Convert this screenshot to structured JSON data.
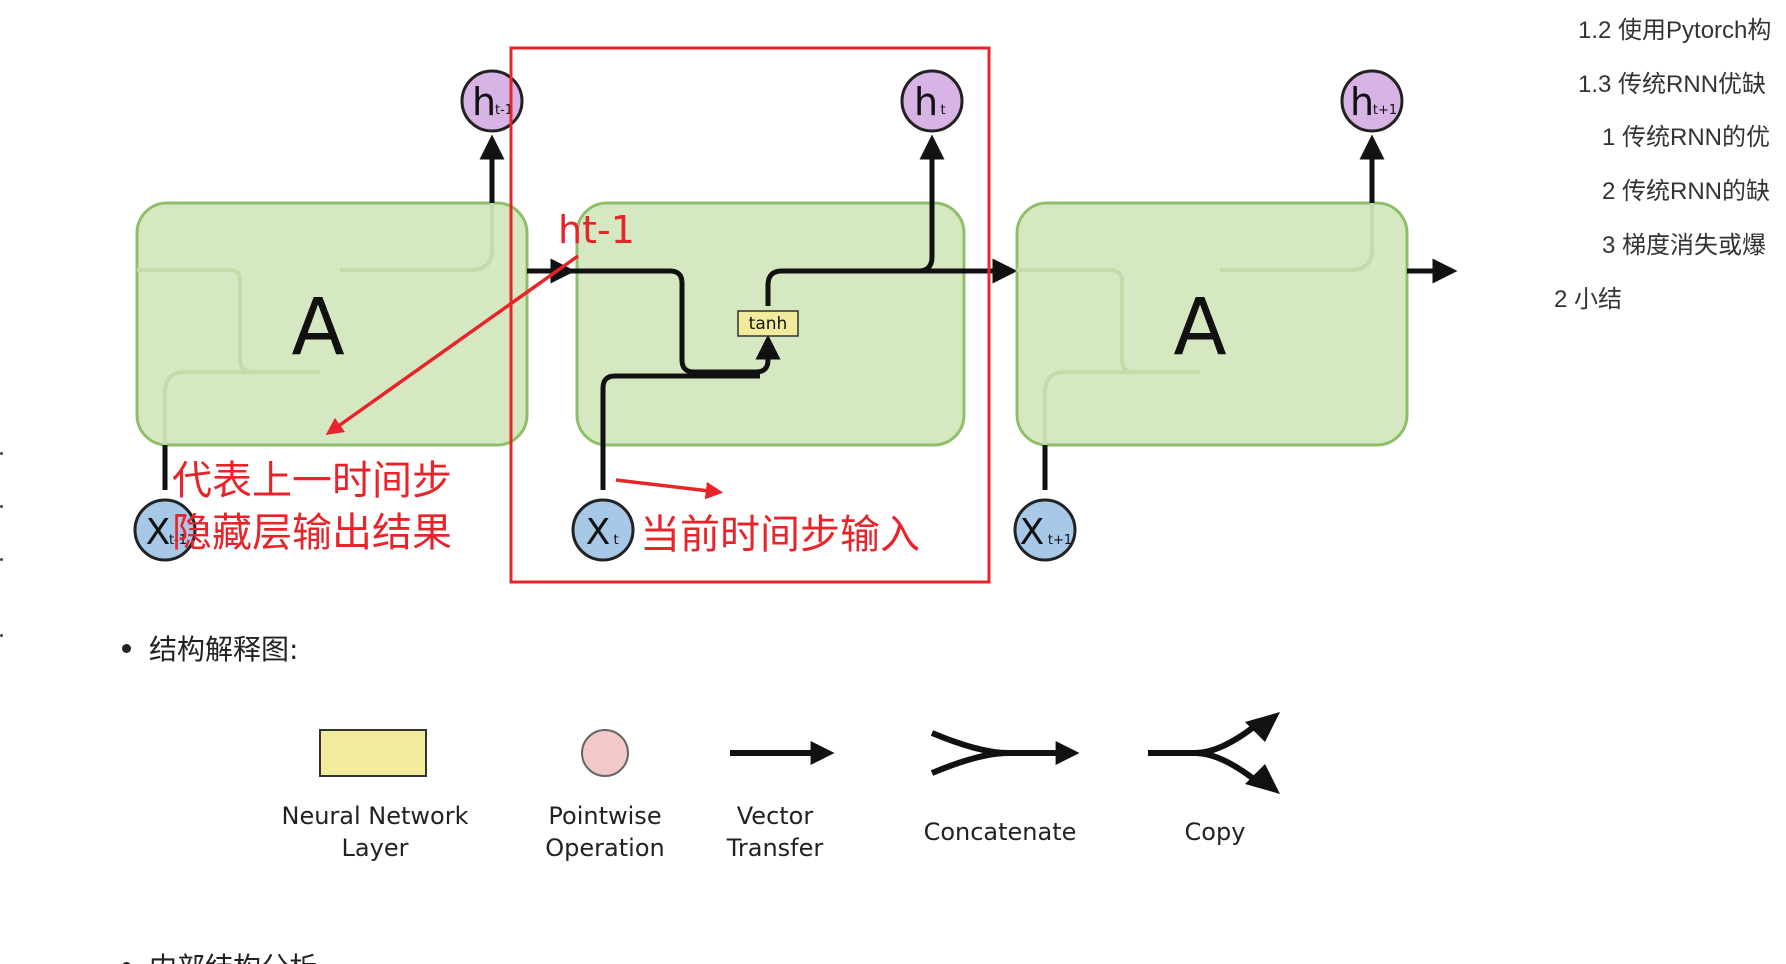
{
  "diagram": {
    "cell_label": "A",
    "h_prev_label": "h",
    "h_prev_sub": "t-1",
    "h_curr_label": "h",
    "h_curr_sub": "t",
    "h_next_label": "h",
    "h_next_sub": "t+1",
    "x_prev_label": "X",
    "x_prev_sub": "t-1",
    "x_curr_label": "X",
    "x_curr_sub": "t",
    "x_next_label": "X",
    "x_next_sub": "t+1",
    "tanh_label": "tanh",
    "annotation_ht1": "ht-1",
    "annotation_prev_line1": "代表上一时间步",
    "annotation_prev_line2": "隐藏层输出结果",
    "annotation_curr_input": "当前时间步输入"
  },
  "bullet": {
    "label": "结构解释图:"
  },
  "legend": {
    "items": [
      {
        "label": "Neural Network\nLayer"
      },
      {
        "label": "Pointwise\nOperation"
      },
      {
        "label": "Vector\nTransfer"
      },
      {
        "label": "Concatenate"
      },
      {
        "label": "Copy"
      }
    ]
  },
  "bottom": {
    "label": "内部结构分析"
  },
  "toc": {
    "items": [
      {
        "label": "1.2 使用Pytorch构"
      },
      {
        "label": "1.3 传统RNN优缺"
      },
      {
        "label": "1 传统RNN的优"
      },
      {
        "label": "2 传统RNN的缺"
      },
      {
        "label": "3 梯度消失或爆"
      },
      {
        "label": "2 小结"
      }
    ]
  },
  "colors": {
    "cell_fill": "#d5e8c2",
    "cell_stroke": "#8fbf6a",
    "h_fill": "#d8b4e6",
    "x_fill": "#a8c8e8",
    "tanh_fill": "#f2eb9c",
    "annotation": "#e8242b",
    "pointwise_fill": "#f2c8c8"
  }
}
